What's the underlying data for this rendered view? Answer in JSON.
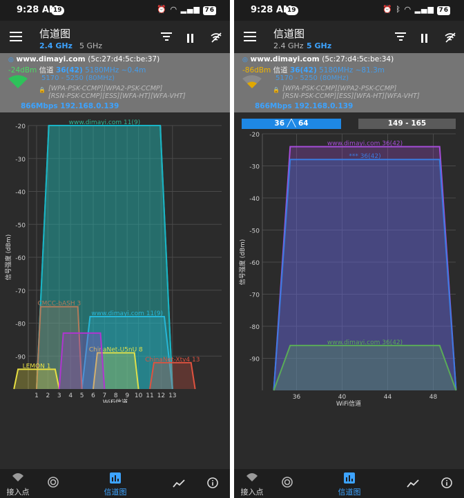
{
  "colors": {
    "accent": "#3da3ff",
    "signal_good": "#2ec25a",
    "signal_weak": "#e0a800"
  },
  "screens": [
    {
      "status": {
        "time": "9:28 AM",
        "badge": "19",
        "battery": "76"
      },
      "appbar": {
        "title": "信道图",
        "band_active": "2.4 GHz",
        "band_other": "5 GHz"
      },
      "connection": {
        "ssid": "www.dimayi.com",
        "mac": "(5c:27:d4:5c:be:37)",
        "signal": "-24dBm",
        "channel_label": "信道",
        "channel": "36(42)",
        "freq": "5180MHz ~0.4m",
        "range": "5170 - 5250 (80MHz)",
        "caps_line1": "[WPA-PSK-CCMP][WPA2-PSK-CCMP]",
        "caps_line2": "[RSN-PSK-CCMP][ESS][WFA-HT][WFA-VHT]",
        "rate_ip": "866Mbps 192.168.0.139"
      },
      "chart_data": {
        "type": "area",
        "ylabel": "信号强度 (dBm)",
        "xlabel": "WiFi信道",
        "ylim": [
          -100,
          -20
        ],
        "y_ticks": [
          -20,
          -30,
          -40,
          -50,
          -60,
          -70,
          -80,
          -90
        ],
        "x_ticks": [
          "1",
          "2",
          "3",
          "4",
          "5",
          "6",
          "7",
          "8",
          "9",
          "10",
          "11",
          "12",
          "13"
        ],
        "x_range": [
          0,
          15
        ],
        "series": [
          {
            "name": "www.dimayi.com 11(9)",
            "label": "www.dimayi.com 11(9)",
            "color": "#2db894",
            "center": 7,
            "half_width": 6,
            "level": -20,
            "top_rounding": 0.9
          },
          {
            "name": "www.dimayi.com 11(9)",
            "label": "",
            "color": "#1ab4c6",
            "center": 7,
            "half_width": 6,
            "level": -20,
            "top_rounding": 0.9
          },
          {
            "name": "www.dimayi.com 11(9)",
            "label": "www.dimayi.com 11(9)",
            "color": "#27b7d8",
            "center": 9,
            "half_width": 4,
            "level": -78
          },
          {
            "name": "CMCC-bASH 3",
            "label": "CMCC-bASH 3",
            "color": "#b37a5a",
            "center": 3,
            "half_width": 2,
            "level": -75
          },
          {
            "name": "LEMON 1",
            "label": "LEMON 1",
            "color": "#e8e042",
            "center": 1,
            "half_width": 2,
            "level": -94
          },
          {
            "name": "ChinaNet-U5nU 8",
            "label": "ChinaNet-U5nU 8",
            "color": "#dfe04a",
            "center": 8,
            "half_width": 2,
            "level": -89
          },
          {
            "name": "5",
            "label": "",
            "color": "#b035d0",
            "center": 5,
            "half_width": 2,
            "level": -83
          },
          {
            "name": "ChinaNet-Xtv4 13",
            "label": "ChinaNet-Xtv4 13",
            "color": "#e0523f",
            "center": 13,
            "half_width": 2,
            "level": -92
          }
        ]
      },
      "nav": {
        "ap": "接入点",
        "chart": "信道图"
      }
    },
    {
      "status": {
        "time": "9:28 AM",
        "badge": "19",
        "battery": "76"
      },
      "appbar": {
        "title": "信道图",
        "band_active": "5 GHz",
        "band_other": "2.4 GHz"
      },
      "connection": {
        "ssid": "www.dimayi.com",
        "mac": "(5c:27:d4:5c:be:34)",
        "signal": "-86dBm",
        "channel_label": "信道",
        "channel": "36(42)",
        "freq": "5180MHz ~81.3m",
        "range": "5170 - 5250 (80MHz)",
        "caps_line1": "[WPA-PSK-CCMP][WPA2-PSK-CCMP]",
        "caps_line2": "[RSN-PSK-CCMP][ESS][WFA-HT][WFA-VHT]",
        "rate_ip": "866Mbps 192.168.0.139"
      },
      "tabs": {
        "left": "36 ╱╲ 64",
        "right": "149 - 165"
      },
      "chart_data": {
        "type": "area",
        "ylabel": "信号强度 (dBm)",
        "xlabel": "WiFi信道",
        "ylim": [
          -100,
          -20
        ],
        "y_ticks": [
          -20,
          -30,
          -40,
          -50,
          -60,
          -70,
          -80,
          -90
        ],
        "x_ticks": [
          "36",
          "40",
          "44",
          "48"
        ],
        "x_range": [
          33,
          51
        ],
        "series": [
          {
            "name": "www.dimayi.com 36(42)",
            "label": "www.dimayi.com 36(42)",
            "color": "#a64cd8",
            "center": 42,
            "half_width": 8,
            "level": -24
          },
          {
            "name": "*** 36(42)",
            "label": "*** 36(42)",
            "color": "#3b7be0",
            "center": 42,
            "half_width": 8,
            "level": -28
          },
          {
            "name": "www.dimayi.com 36(42)",
            "label": "www.dimayi.com 36(42)",
            "color": "#5aab58",
            "center": 42,
            "half_width": 8,
            "level": -86
          }
        ]
      },
      "nav": {
        "ap": "接入点",
        "chart": "信道图"
      }
    }
  ]
}
